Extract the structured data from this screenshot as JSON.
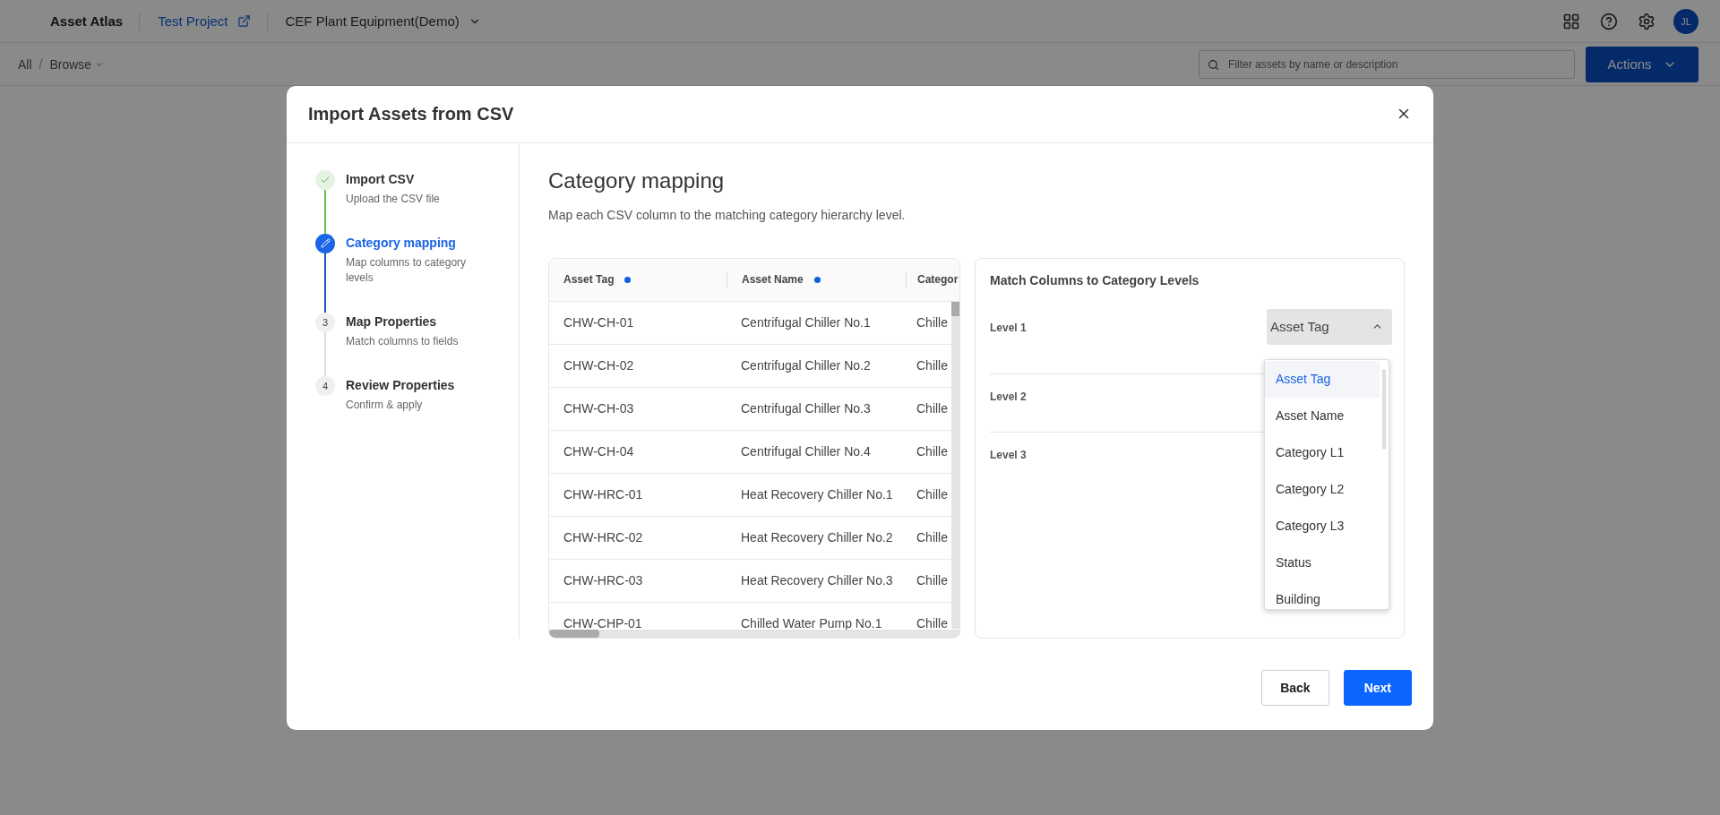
{
  "topbar": {
    "logo": "Asset Atlas",
    "project": "Test Project",
    "dataset": "CEF Plant Equipment(Demo)",
    "avatar": "JL"
  },
  "subbar": {
    "breadcrumbs": [
      "All",
      "Browse"
    ],
    "separator": "/",
    "search": {
      "placeholder": "Filter assets by name or description"
    },
    "actions": "Actions"
  },
  "dialog": {
    "title": "Import Assets from CSV",
    "steps": [
      {
        "kind": "done",
        "title": "Import CSV",
        "subtitle": "Upload the CSV file"
      },
      {
        "kind": "active",
        "title": "Category mapping",
        "subtitle": "Map columns to category levels"
      },
      {
        "kind": "pending",
        "number": "3",
        "title": "Map Properties",
        "subtitle": "Match columns to fields"
      },
      {
        "kind": "pending",
        "number": "4",
        "title": "Review Properties",
        "subtitle": "Confirm & apply"
      }
    ],
    "heading": "Category mapping",
    "description": "Map each CSV column to the matching category hierarchy level.",
    "table": {
      "columns": [
        {
          "label": "Asset Tag",
          "required": true
        },
        {
          "label": "Asset Name",
          "required": true
        },
        {
          "label": "Categor"
        }
      ],
      "rows": [
        [
          "CHW-CH-01",
          "Centrifugal Chiller No.1",
          "Chille"
        ],
        [
          "CHW-CH-02",
          "Centrifugal Chiller No.2",
          "Chille"
        ],
        [
          "CHW-CH-03",
          "Centrifugal Chiller No.3",
          "Chille"
        ],
        [
          "CHW-CH-04",
          "Centrifugal Chiller No.4",
          "Chille"
        ],
        [
          "CHW-HRC-01",
          "Heat Recovery Chiller No.1",
          "Chille"
        ],
        [
          "CHW-HRC-02",
          "Heat Recovery Chiller No.2",
          "Chille"
        ],
        [
          "CHW-HRC-03",
          "Heat Recovery Chiller No.3",
          "Chille"
        ],
        [
          "CHW-CHP-01",
          "Chilled Water Pump No.1",
          "Chille"
        ]
      ]
    },
    "mapping": {
      "title": "Match Columns to Category Levels",
      "levels": [
        {
          "label": "Level 1",
          "value": "Asset Tag",
          "expanded": true
        },
        {
          "label": "Level 2"
        },
        {
          "label": "Level 3"
        }
      ],
      "options": [
        {
          "label": "Asset Tag",
          "selected": true
        },
        {
          "label": "Asset Name",
          "selected": false
        },
        {
          "label": "Category L1",
          "selected": false
        },
        {
          "label": "Category L2",
          "selected": false
        },
        {
          "label": "Category L3",
          "selected": false
        },
        {
          "label": "Status",
          "selected": false
        },
        {
          "label": "Building",
          "selected": false
        }
      ]
    },
    "buttons": {
      "back": "Back",
      "next": "Next"
    }
  }
}
